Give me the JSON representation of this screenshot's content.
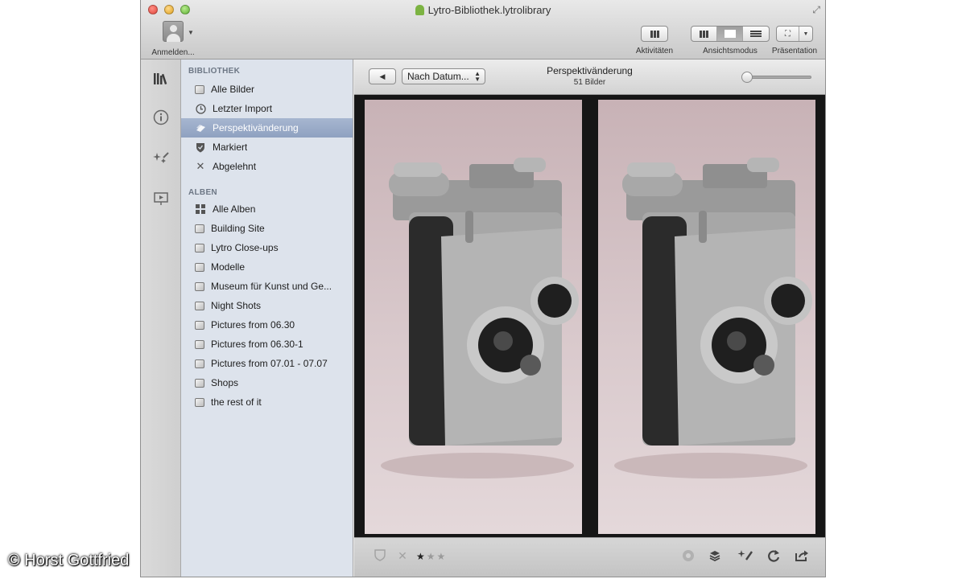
{
  "window": {
    "title": "Lytro-Bibliothek.lytrolibrary"
  },
  "toolbar": {
    "account_label": "Anmelden...",
    "activities_label": "Aktivitäten",
    "view_mode_label": "Ansichtsmodus",
    "presentation_label": "Präsentation"
  },
  "rail": {
    "icons": [
      "library-icon",
      "info-icon",
      "effects-icon",
      "slideshow-icon"
    ]
  },
  "sidebar": {
    "library_header": "BIBLIOTHEK",
    "library_items": [
      {
        "label": "Alle Bilder",
        "icon": "photo-stack-icon"
      },
      {
        "label": "Letzter Import",
        "icon": "clock-icon"
      },
      {
        "label": "Perspektivänderung",
        "icon": "perspective-icon"
      },
      {
        "label": "Markiert",
        "icon": "shield-icon"
      },
      {
        "label": "Abgelehnt",
        "icon": "x-icon"
      }
    ],
    "selected": "Perspektivänderung",
    "albums_header": "ALBEN",
    "album_items": [
      {
        "label": "Alle Alben",
        "icon": "grid-icon"
      },
      {
        "label": "Building Site",
        "icon": "album-icon"
      },
      {
        "label": "Lytro Close-ups",
        "icon": "album-icon"
      },
      {
        "label": "Modelle",
        "icon": "album-icon"
      },
      {
        "label": "Museum für Kunst und Ge...",
        "icon": "album-icon"
      },
      {
        "label": "Night Shots",
        "icon": "album-icon"
      },
      {
        "label": "Pictures from 06.30",
        "icon": "album-icon"
      },
      {
        "label": "Pictures from 06.30-1",
        "icon": "album-icon"
      },
      {
        "label": "Pictures from 07.01 - 07.07",
        "icon": "album-icon"
      },
      {
        "label": "Shops",
        "icon": "album-icon"
      },
      {
        "label": "the rest of it",
        "icon": "album-icon"
      }
    ]
  },
  "main": {
    "back_glyph": "◀",
    "sort_value": "Nach Datum...",
    "album_title": "Perspektivänderung",
    "album_count": "51 Bilder",
    "zoom_level": 0.0
  },
  "bottombar": {
    "rating_value": 1,
    "rating_max": 3
  },
  "credit": "© Horst Gottfried",
  "colors": {
    "selection": "#97a8c5",
    "sidebar_bg": "#dde3ec",
    "viewer_bg": "#161616"
  }
}
